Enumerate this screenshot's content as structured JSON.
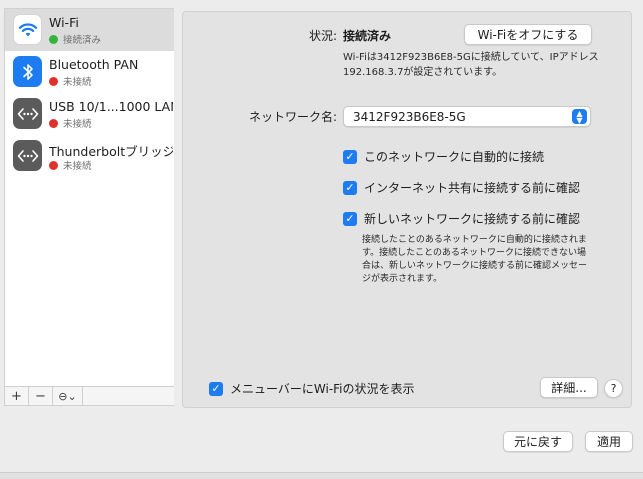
{
  "sidebar": {
    "services": [
      {
        "name": "Wi-Fi",
        "status": "接続済み",
        "status_color": "#35b33c",
        "icon": "wifi-icon",
        "selected": true
      },
      {
        "name": "Bluetooth PAN",
        "status": "未接続",
        "status_color": "#e0302a",
        "icon": "bluetooth-icon",
        "selected": false
      },
      {
        "name": "USB 10/1...1000 LAN",
        "status": "未接続",
        "status_color": "#e0302a",
        "icon": "ethernet-icon",
        "selected": false
      },
      {
        "name": "Thunderboltブリッジ",
        "status": "未接続",
        "status_color": "#e0302a",
        "icon": "ethernet-icon",
        "selected": false
      }
    ],
    "toolbar": {
      "add_label": "+",
      "remove_label": "−",
      "action_label": "⊖⌄"
    }
  },
  "panel": {
    "status_label": "状況:",
    "status_value": "接続済み",
    "wifi_off_button": "Wi-Fiをオフにする",
    "status_description": "Wi-Fiは3412F923B6E8-5Gに接続していて、IPアドレス 192.168.3.7が設定されています。",
    "network_name_label": "ネットワーク名:",
    "network_name_value": "3412F923B6E8-5G",
    "options": [
      {
        "label": "このネットワークに自動的に接続",
        "checked": true
      },
      {
        "label": "インターネット共有に接続する前に確認",
        "checked": true
      },
      {
        "label": "新しいネットワークに接続する前に確認",
        "checked": true
      }
    ],
    "ask_description": "接続したことのあるネットワークに自動的に接続されます。接続したことのあるネットワークに接続できない場合は、新しいネットワークに接続する前に確認メッセージが表示されます。",
    "menu_bar_option": {
      "label": "メニューバーにWi-Fiの状況を表示",
      "checked": true
    },
    "details_button": "詳細...",
    "help_button": "?"
  },
  "footer": {
    "revert_button": "元に戻す",
    "apply_button": "適用"
  },
  "colors": {
    "accent": "#1d7cf2",
    "connected": "#35b33c",
    "disconnected": "#e0302a"
  }
}
